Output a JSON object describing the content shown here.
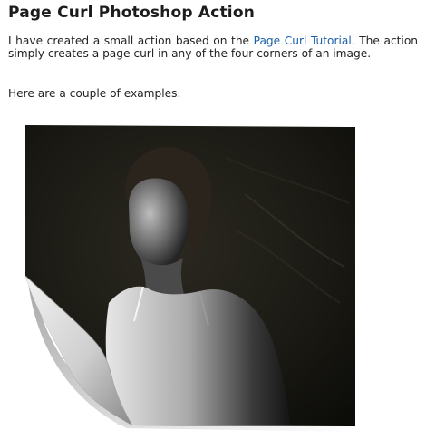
{
  "article": {
    "title": "Page Curl Photoshop Action",
    "intro_before_link": "I have created a small action based on the ",
    "intro_link": "Page Curl Tutorial",
    "intro_after_link": ". The action simply creates a page curl in any of the four corners of an image.",
    "examples_text": "Here are a couple of examples."
  },
  "colors": {
    "link": "#1a5fa8",
    "text": "#222222",
    "background": "#ffffff"
  },
  "image": {
    "subject": "page-curl-example-portrait"
  }
}
